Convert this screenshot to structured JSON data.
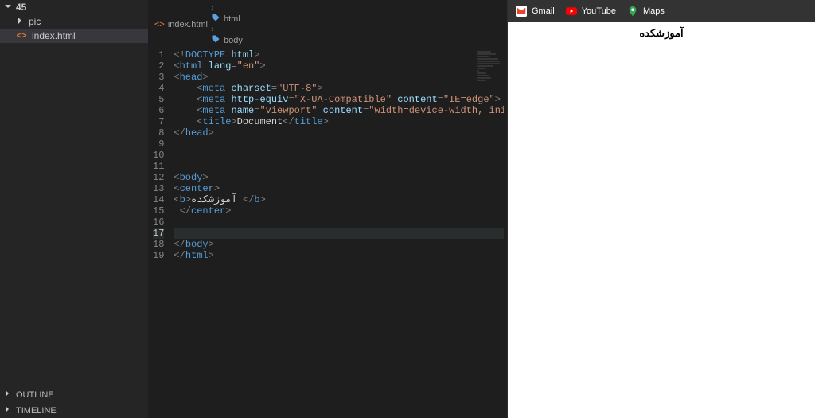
{
  "explorer": {
    "root_label": "45",
    "items": [
      {
        "type": "folder",
        "label": "pic"
      },
      {
        "type": "file",
        "label": "index.html",
        "selected": true
      }
    ],
    "panels": [
      "OUTLINE",
      "TIMELINE"
    ]
  },
  "breadcrumb": {
    "file": "index.html",
    "path": [
      "html",
      "body"
    ]
  },
  "code_lines": [
    [
      {
        "t": "<!",
        "c": "c-punct"
      },
      {
        "t": "DOCTYPE",
        "c": "c-doct"
      },
      {
        "t": " ",
        "c": ""
      },
      {
        "t": "html",
        "c": "c-attr"
      },
      {
        "t": ">",
        "c": "c-punct"
      }
    ],
    [
      {
        "t": "<",
        "c": "c-punct"
      },
      {
        "t": "html",
        "c": "c-tag"
      },
      {
        "t": " ",
        "c": ""
      },
      {
        "t": "lang",
        "c": "c-attr"
      },
      {
        "t": "=",
        "c": "c-punct"
      },
      {
        "t": "\"en\"",
        "c": "c-str"
      },
      {
        "t": ">",
        "c": "c-punct"
      }
    ],
    [
      {
        "t": "<",
        "c": "c-punct"
      },
      {
        "t": "head",
        "c": "c-tag"
      },
      {
        "t": ">",
        "c": "c-punct"
      }
    ],
    [
      {
        "t": "    <",
        "c": "c-punct"
      },
      {
        "t": "meta",
        "c": "c-tag"
      },
      {
        "t": " ",
        "c": ""
      },
      {
        "t": "charset",
        "c": "c-attr"
      },
      {
        "t": "=",
        "c": "c-punct"
      },
      {
        "t": "\"UTF-8\"",
        "c": "c-str"
      },
      {
        "t": ">",
        "c": "c-punct"
      }
    ],
    [
      {
        "t": "    <",
        "c": "c-punct"
      },
      {
        "t": "meta",
        "c": "c-tag"
      },
      {
        "t": " ",
        "c": ""
      },
      {
        "t": "http-equiv",
        "c": "c-attr"
      },
      {
        "t": "=",
        "c": "c-punct"
      },
      {
        "t": "\"X-UA-Compatible\"",
        "c": "c-str"
      },
      {
        "t": " ",
        "c": ""
      },
      {
        "t": "content",
        "c": "c-attr"
      },
      {
        "t": "=",
        "c": "c-punct"
      },
      {
        "t": "\"IE=edge\"",
        "c": "c-str"
      },
      {
        "t": ">",
        "c": "c-punct"
      }
    ],
    [
      {
        "t": "    <",
        "c": "c-punct"
      },
      {
        "t": "meta",
        "c": "c-tag"
      },
      {
        "t": " ",
        "c": ""
      },
      {
        "t": "name",
        "c": "c-attr"
      },
      {
        "t": "=",
        "c": "c-punct"
      },
      {
        "t": "\"viewport\"",
        "c": "c-str"
      },
      {
        "t": " ",
        "c": ""
      },
      {
        "t": "content",
        "c": "c-attr"
      },
      {
        "t": "=",
        "c": "c-punct"
      },
      {
        "t": "\"width=device-width, initial",
        "c": "c-str"
      }
    ],
    [
      {
        "t": "    <",
        "c": "c-punct"
      },
      {
        "t": "title",
        "c": "c-tag"
      },
      {
        "t": ">",
        "c": "c-punct"
      },
      {
        "t": "Document",
        "c": "c-text"
      },
      {
        "t": "</",
        "c": "c-punct"
      },
      {
        "t": "title",
        "c": "c-tag"
      },
      {
        "t": ">",
        "c": "c-punct"
      }
    ],
    [
      {
        "t": "</",
        "c": "c-punct"
      },
      {
        "t": "head",
        "c": "c-tag"
      },
      {
        "t": ">",
        "c": "c-punct"
      }
    ],
    [],
    [],
    [],
    [
      {
        "t": "<",
        "c": "c-punct"
      },
      {
        "t": "body",
        "c": "c-tag"
      },
      {
        "t": ">",
        "c": "c-punct"
      }
    ],
    [
      {
        "t": "<",
        "c": "c-punct"
      },
      {
        "t": "center",
        "c": "c-tag"
      },
      {
        "t": ">",
        "c": "c-punct"
      }
    ],
    [
      {
        "t": "<",
        "c": "c-punct"
      },
      {
        "t": "b",
        "c": "c-tag"
      },
      {
        "t": ">",
        "c": "c-punct"
      },
      {
        "t": "آموزشکده",
        "c": "c-text"
      },
      {
        "t": " </",
        "c": "c-punct"
      },
      {
        "t": "b",
        "c": "c-tag"
      },
      {
        "t": ">",
        "c": "c-punct"
      }
    ],
    [
      {
        "t": " </",
        "c": "c-punct"
      },
      {
        "t": "center",
        "c": "c-tag"
      },
      {
        "t": ">",
        "c": "c-punct"
      }
    ],
    [],
    [],
    [
      {
        "t": "</",
        "c": "c-punct"
      },
      {
        "t": "body",
        "c": "c-tag"
      },
      {
        "t": ">",
        "c": "c-punct"
      }
    ],
    [
      {
        "t": "</",
        "c": "c-punct"
      },
      {
        "t": "html",
        "c": "c-tag"
      },
      {
        "t": ">",
        "c": "c-punct"
      }
    ]
  ],
  "active_line": 17,
  "browser_bar": {
    "items": [
      {
        "label": "Gmail",
        "icon": "gmail"
      },
      {
        "label": "YouTube",
        "icon": "youtube"
      },
      {
        "label": "Maps",
        "icon": "maps"
      }
    ]
  },
  "preview_text": "آموزشکده"
}
